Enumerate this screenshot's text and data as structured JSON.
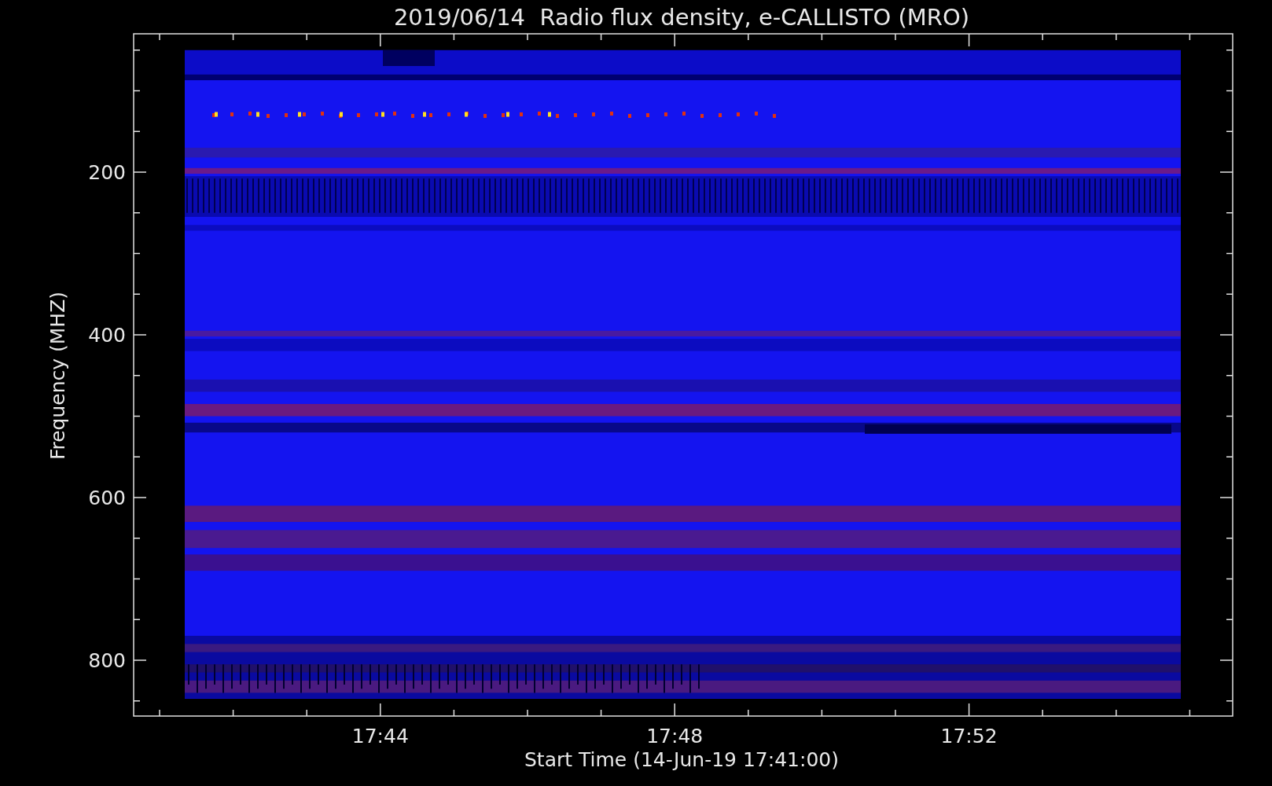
{
  "plot": {
    "title": "2019/06/14  Radio flux density, e-CALLISTO (MRO)",
    "ylabel": "Frequency (MHZ)",
    "xlabel": "Start Time (14-Jun-19 17:41:00)",
    "yticks": [
      "200",
      "400",
      "600",
      "800"
    ],
    "xticks": [
      "17:44",
      "17:48",
      "17:52"
    ]
  }
}
